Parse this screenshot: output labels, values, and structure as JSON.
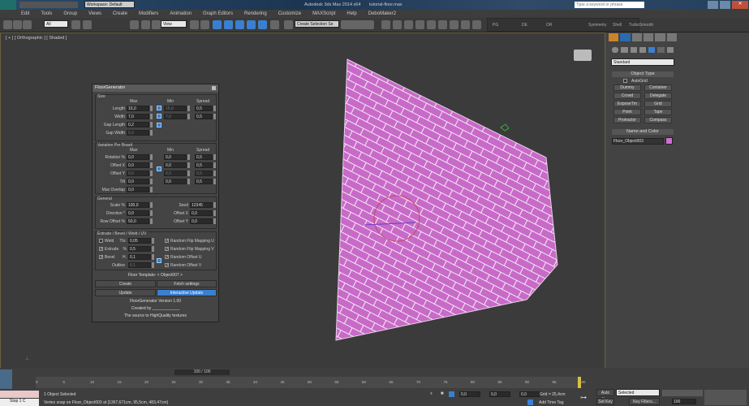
{
  "title": {
    "workspace": "Workspace: Default",
    "app": "Autodesk 3ds Max 2014 x64",
    "file": "tutorial-floor.max",
    "search_placeholder": "Type a keyword or phrase"
  },
  "menu": [
    "Edit",
    "Tools",
    "Group",
    "Views",
    "Create",
    "Modifiers",
    "Animation",
    "Graph Editors",
    "Rendering",
    "Customize",
    "MAXScript",
    "Help",
    "DeboMaker2"
  ],
  "toolbar": {
    "filter": "All",
    "ref_coord": "View",
    "selection_set": "Create Selection Se",
    "ribbon": [
      "PG",
      "DE",
      "OR",
      "Symmetry",
      "Shell",
      "TurboSmooth"
    ]
  },
  "viewport": {
    "label": "[ + ] [ Orthographic ] [ Shaded ]",
    "floor_color": "#c86ac8"
  },
  "dialog": {
    "title": "FloorGenerator",
    "size": {
      "label": "Size",
      "cols": [
        "Max",
        "Min",
        "Spread"
      ],
      "rows": [
        {
          "label": "Length",
          "max": "15,0",
          "min": "15,0",
          "spread": "0,5"
        },
        {
          "label": "Width",
          "max": "7,0",
          "min": "7,0",
          "spread": "0,5"
        },
        {
          "label": "Gap Length",
          "max": "0,2"
        },
        {
          "label": "Gap Width",
          "max": "0,2"
        }
      ]
    },
    "variation": {
      "label": "Variation Per Board",
      "cols": [
        "Max",
        "Min",
        "Spread"
      ],
      "rows": [
        {
          "label": "Rotation %",
          "max": "0,0",
          "min": "0,0",
          "spread": "0,5"
        },
        {
          "label": "Offset X",
          "max": "0,0",
          "min": "0,0",
          "spread": "0,5"
        },
        {
          "label": "Offset Y",
          "max": "0,0",
          "min": "0,0",
          "spread": "0,5"
        },
        {
          "label": "Tilt",
          "max": "0,0",
          "min": "0,0",
          "spread": "0,5"
        },
        {
          "label": "Max Overlap",
          "max": "0,0"
        }
      ]
    },
    "general": {
      "label": "General",
      "scale_label": "Scale %",
      "scale": "100,0",
      "direction_label": "Direction °",
      "direction": "0,0",
      "row_offset_label": "Row Offset %",
      "row_offset": "50,0",
      "seed_label": "Seed",
      "seed": "12345",
      "offx_label": "Offset X",
      "offx": "0,0",
      "offy_label": "Offset Y",
      "offy": "0,0"
    },
    "extrude": {
      "label": "Extrude / Bevel / Weld / UV",
      "weld": "Weld",
      "thr_label": "Thr.",
      "thr": "0,05",
      "extrude": "Extrude",
      "ext_label": "%",
      "ext": "0,5",
      "bevel": "Bevel",
      "h_label": "H.",
      "h": "0,1",
      "outline": "Outline",
      "outline_val": "0,1",
      "flip_u": "Random Flip Mapping U",
      "flip_v": "Random Flip Mapping V",
      "off_u": "Random Offset U",
      "off_v": "Random Offset V"
    },
    "template": "Floor Template: < Object007 >",
    "create": "Create",
    "fetch": "Fetch settings",
    "update": "Update",
    "interactive": "Interactive Update",
    "version": "FloorGenerator Version 1.00",
    "created": "Created by ____________",
    "source": "The source to HighQuality textures"
  },
  "panel": {
    "dropdown": "Standard",
    "object_type": "Object Type",
    "autogrid": "AutoGrid",
    "buttons": [
      "Dummy",
      "Container",
      "Crowd",
      "Delegate",
      "ExposeTm",
      "Grid",
      "Point",
      "Tape",
      "Protractor",
      "Compass"
    ],
    "name_color": "Name and Color",
    "name": "Floor_Object003",
    "color": "#d070d0"
  },
  "timeline": {
    "frame": "100 / 100",
    "ticks": [
      "0",
      "5",
      "10",
      "15",
      "20",
      "25",
      "30",
      "35",
      "40",
      "45",
      "50",
      "55",
      "60",
      "65",
      "70",
      "75",
      "80",
      "85",
      "90",
      "95",
      "100"
    ]
  },
  "status": {
    "selected": "1 Object Selected",
    "prompt": "Vertex snap on Floor_Object003 at [1367,671cm, 95,5cm, 483,47cm]",
    "maxscript": "Stop  1  C",
    "x": "0,0",
    "y": "0,0",
    "z": "0,0",
    "grid": "Grid = 25,4cm",
    "add_time_tag": "Add Time Tag",
    "auto_key": "Auto Key",
    "key_mode": "Selected",
    "set_key": "Set Key",
    "key_filters": "Key Filters...",
    "frame": "100"
  }
}
